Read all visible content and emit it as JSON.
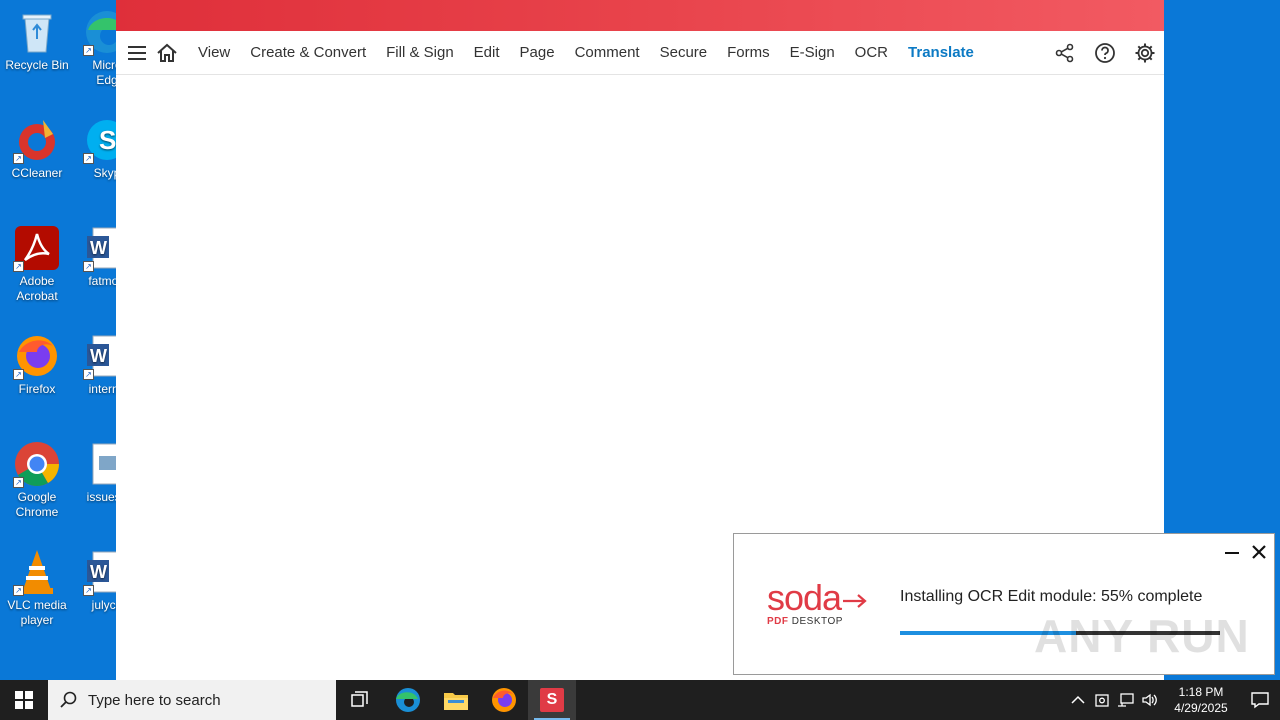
{
  "desktop": {
    "icons": [
      {
        "label": "Recycle Bin"
      },
      {
        "label": "Micro\nEdg"
      },
      {
        "label": "CCleaner"
      },
      {
        "label": "Skyp"
      },
      {
        "label": "Adobe\nAcrobat"
      },
      {
        "label": "fatmort"
      },
      {
        "label": "Firefox"
      },
      {
        "label": "interne"
      },
      {
        "label": "Google\nChrome"
      },
      {
        "label": "issuesh"
      },
      {
        "label": "VLC media\nplayer"
      },
      {
        "label": "julyca"
      }
    ]
  },
  "app": {
    "menu": {
      "items": [
        "View",
        "Create & Convert",
        "Fill & Sign",
        "Edit",
        "Page",
        "Comment",
        "Secure",
        "Forms",
        "E-Sign",
        "OCR",
        "Translate"
      ],
      "active": "Translate",
      "accent_color": "#0c7ac4"
    },
    "brand_color": "#e03b46"
  },
  "install_popup": {
    "logo_word": "soda",
    "logo_sub_pdf": "PDF",
    "logo_sub_desktop": "DESKTOP",
    "status_text": "Installing OCR Edit module: 55% complete",
    "progress_percent": 55,
    "watermark": "ANY RUN"
  },
  "taskbar": {
    "search_placeholder": "Type here to search",
    "time": "1:18 PM",
    "date": "4/29/2025",
    "active_app_letter": "S"
  }
}
